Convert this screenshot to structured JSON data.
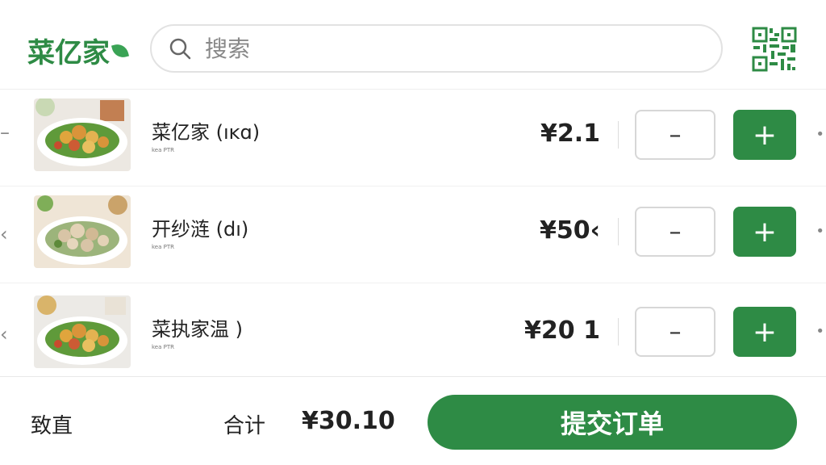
{
  "header": {
    "logo_text": "菜亿家",
    "search_placeholder": "搜索"
  },
  "items": [
    {
      "name": "菜亿家 (ıĸɑ)",
      "sub": "kea PTR",
      "price": "¥2.1"
    },
    {
      "name": "开纱涟 (dı)",
      "sub": "kea PTR",
      "price": "¥50‹"
    },
    {
      "name": "菜执家温 )",
      "sub": "kea PTR",
      "price": "¥20 1"
    }
  ],
  "controls": {
    "minus": "–",
    "plus": "+"
  },
  "footer": {
    "left_label": "致直",
    "total_label": "合计",
    "total_value": "¥30.10",
    "submit_label": "提交订单"
  },
  "colors": {
    "brand_green": "#2e8b45",
    "border_gray": "#d7d7d7"
  }
}
